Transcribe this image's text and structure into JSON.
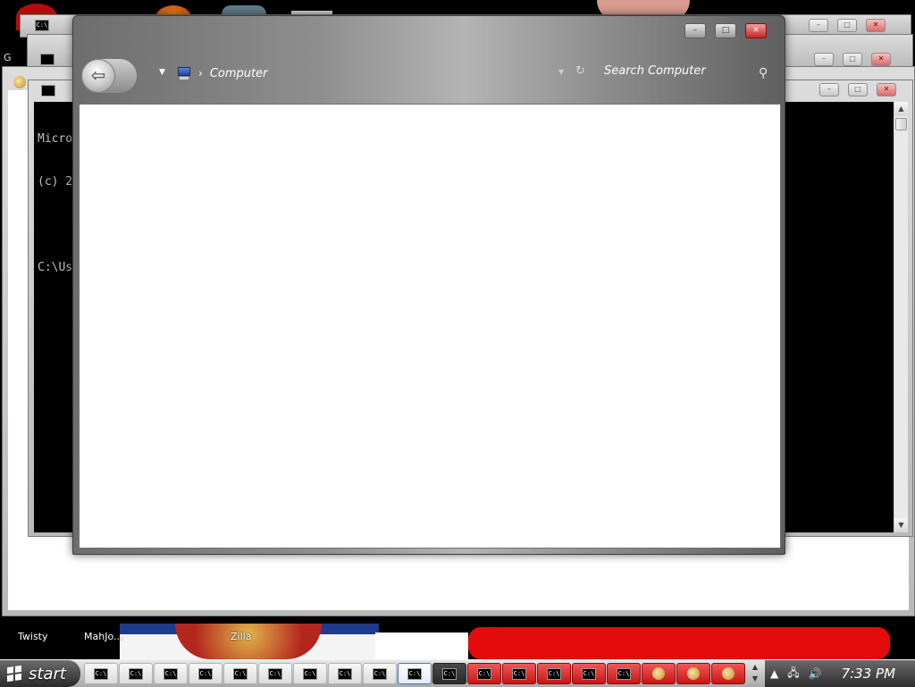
{
  "desktop": {
    "labels": {
      "twisty": "Twisty",
      "mahjong": "MahJo...",
      "zilla": "Zilla"
    },
    "left_edge_text": "G"
  },
  "background_windows": {
    "cmd_top": {
      "title": "C:\\",
      "icon": "cmd-icon"
    },
    "paint_window": {
      "icon": "paint-palette-icon"
    },
    "cmd_console": {
      "title_icon": "cmd-icon",
      "lines": [
        "Micro",
        "(c) 2",
        "",
        "C:\\Us"
      ]
    }
  },
  "explorer": {
    "address_segments": [
      "Computer"
    ],
    "search_placeholder": "Search Computer",
    "caption_buttons": {
      "minimize": "–",
      "maximize": "□",
      "close": "✕"
    }
  },
  "taskbar": {
    "start_label": "start",
    "task_icon_label": "C:\\",
    "clock": "7:33 PM",
    "tray_icons": [
      "expand-tray-icon",
      "network-icon",
      "volume-icon"
    ]
  },
  "colors": {
    "close_red": "#c62828",
    "taskbar_red": "#c81414",
    "console_bg": "#000000"
  }
}
